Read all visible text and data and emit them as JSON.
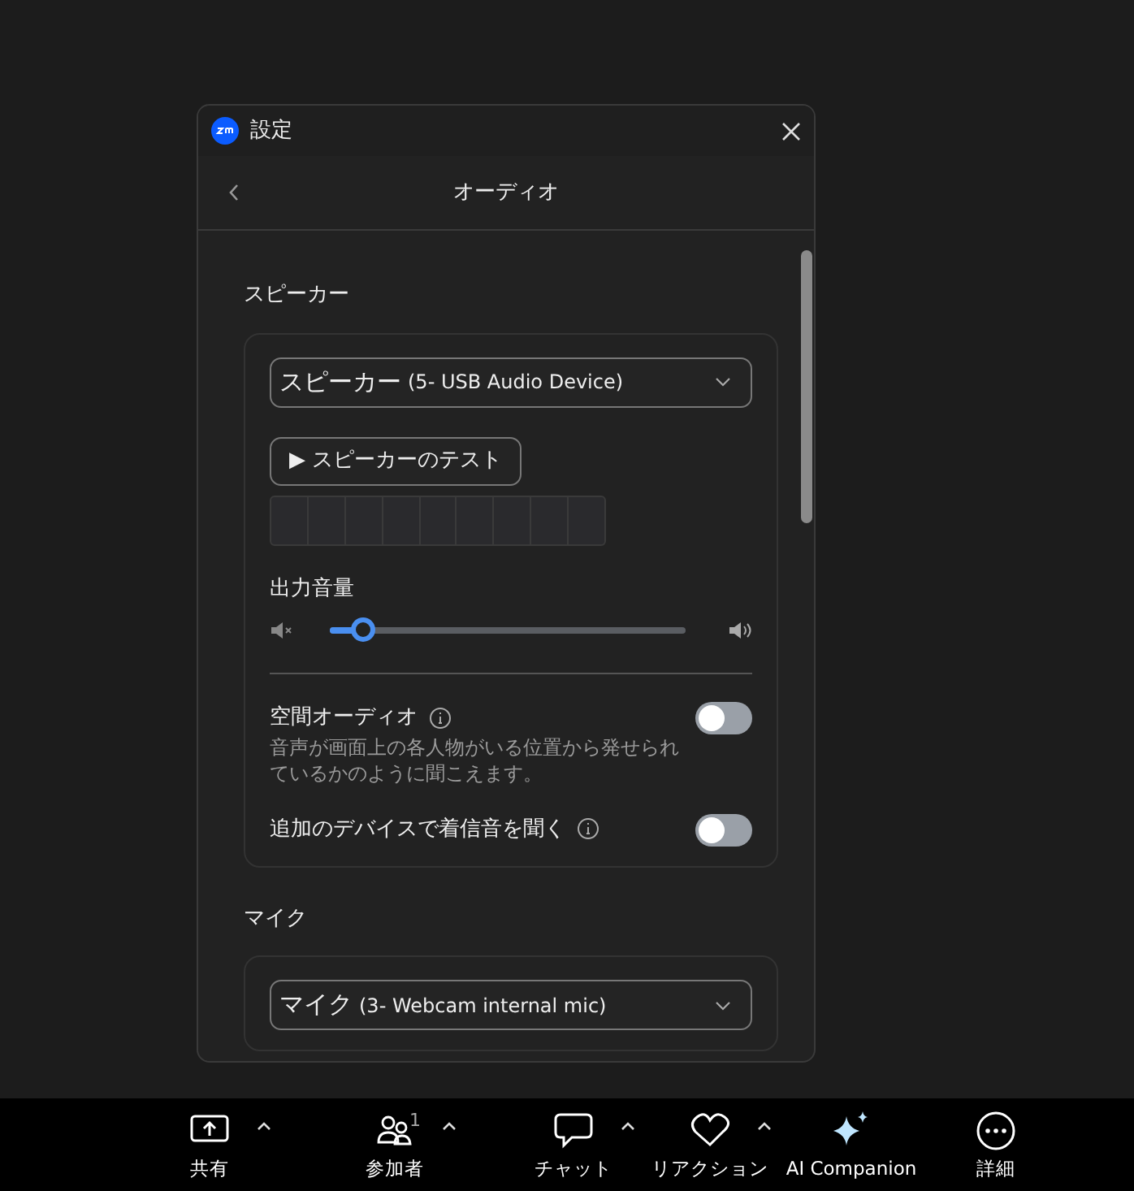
{
  "window": {
    "title": "設定"
  },
  "header": {
    "title": "オーディオ"
  },
  "speaker": {
    "heading": "スピーカー",
    "dropdown": {
      "label": "スピーカー",
      "detail": "(5- USB Audio Device)"
    },
    "test_button": {
      "symbol": "▶",
      "label": "スピーカーのテスト"
    },
    "volume": {
      "label": "出力音量",
      "level": 0.09
    },
    "toggles": [
      {
        "label": "空間オーディオ",
        "description": "音声が画面上の各人物がいる位置から発せられているかのように聞こえます。",
        "on": false
      },
      {
        "label": "追加のデバイスで着信音を聞く",
        "on": false
      }
    ]
  },
  "microphone": {
    "heading": "マイク",
    "dropdown": {
      "label": "マイク",
      "detail": "(3- Webcam internal mic)"
    }
  },
  "toolbar": [
    {
      "label": "共有",
      "caret": true
    },
    {
      "label": "参加者",
      "badge": "1",
      "caret": true
    },
    {
      "label": "チャット",
      "caret": true
    },
    {
      "label": "リアクション",
      "caret": true
    },
    {
      "label": "AI Companion",
      "caret": false
    },
    {
      "label": "詳細",
      "caret": false
    }
  ]
}
